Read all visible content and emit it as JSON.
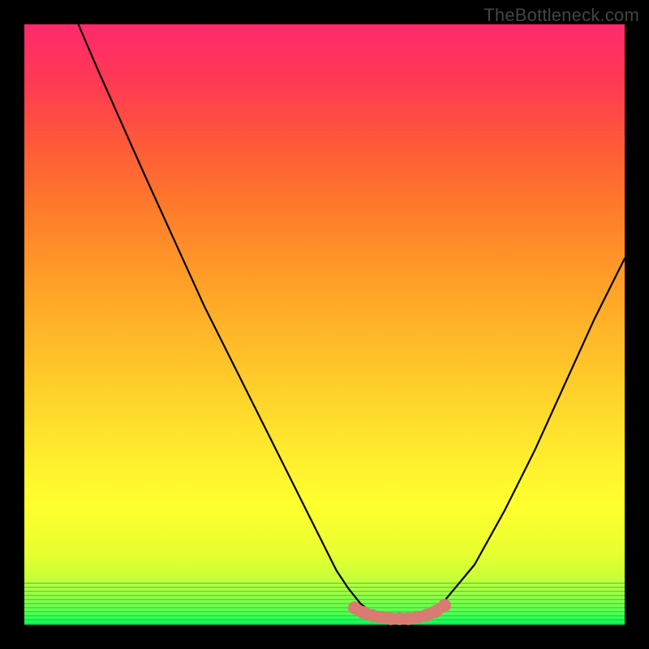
{
  "watermark": "TheBottleneck.com",
  "colors": {
    "frame": "#000000",
    "curve_stroke": "#000000",
    "marker_fill": "#d97a73",
    "gradient_top": "#ff2a6c",
    "gradient_bottom": "#00ff55"
  },
  "chart_data": {
    "type": "line",
    "title": "",
    "xlabel": "",
    "ylabel": "",
    "xlim": [
      0,
      100
    ],
    "ylim": [
      0,
      100
    ],
    "series": [
      {
        "name": "bottleneck-curve",
        "x": [
          9,
          12,
          16,
          20,
          25,
          30,
          35,
          40,
          45,
          50,
          52,
          54,
          56,
          58,
          60,
          62,
          64,
          66,
          68,
          70,
          75,
          80,
          85,
          90,
          95,
          100
        ],
        "y": [
          100,
          93,
          84,
          75,
          64,
          53,
          43,
          33,
          23,
          13,
          9,
          6,
          3.5,
          2,
          1,
          1,
          1,
          1.5,
          2.5,
          4,
          10,
          19,
          29,
          40,
          51,
          61
        ]
      }
    ],
    "markers": {
      "name": "flat-bottom-markers",
      "x_start": 55,
      "x_end": 70,
      "y": 1.5,
      "approx_points": [
        [
          55,
          2.8
        ],
        [
          56.5,
          2.0
        ],
        [
          58,
          1.5
        ],
        [
          59.5,
          1.2
        ],
        [
          61,
          1.0
        ],
        [
          62.5,
          1.0
        ],
        [
          64,
          1.0
        ],
        [
          65.5,
          1.2
        ],
        [
          67,
          1.6
        ],
        [
          68.5,
          2.2
        ],
        [
          70,
          3.2
        ]
      ]
    }
  }
}
